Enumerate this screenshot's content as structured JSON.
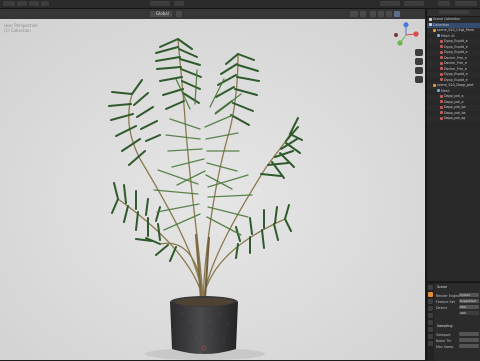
{
  "viewport": {
    "mode_label": "Global",
    "overlay_lines": [
      "User Perspective",
      "(1) Collection"
    ],
    "gizmo_axes": [
      "X",
      "Y",
      "Z"
    ],
    "background": "#dcdcdc"
  },
  "outliner": {
    "rows": [
      {
        "label": "Scene Collection",
        "icon": "collection-icon"
      },
      {
        "label": "Collection",
        "icon": "collection-icon"
      },
      {
        "label": "scene_S10_Clrgt_Parm",
        "icon": "object-icon"
      },
      {
        "label": "Mesh 41",
        "icon": "mesh-icon"
      },
      {
        "label": "Dypp_Euptd_e",
        "icon": "material-icon"
      },
      {
        "label": "Dypp_Euptd_e",
        "icon": "material-icon"
      },
      {
        "label": "Dypp_Euptd_e",
        "icon": "material-icon"
      },
      {
        "label": "Dschm_Frm_e",
        "icon": "material-icon"
      },
      {
        "label": "Dschm_Frm_e",
        "icon": "material-icon"
      },
      {
        "label": "Dschm_Frm_e",
        "icon": "material-icon"
      },
      {
        "label": "Dypp_Euptd_e",
        "icon": "material-icon"
      },
      {
        "label": "Dypp_Euptd_e",
        "icon": "material-icon"
      },
      {
        "label": "scene_S10_Dapp_port",
        "icon": "object-icon"
      },
      {
        "label": "Mesh",
        "icon": "mesh-icon"
      },
      {
        "label": "Dapp_pot_a",
        "icon": "material-icon"
      },
      {
        "label": "Dapp_pot_a",
        "icon": "material-icon"
      },
      {
        "label": "Dapp_pot_ba",
        "icon": "material-icon"
      },
      {
        "label": "Dapp_pot_ba",
        "icon": "material-icon"
      },
      {
        "label": "Dapp_pot_sg",
        "icon": "material-icon"
      }
    ]
  },
  "properties": {
    "section": "Scene",
    "rows": [
      {
        "label": "Render Engine",
        "value": "Cycles"
      },
      {
        "label": "Feature Set",
        "value": "Supported"
      },
      {
        "label": "Device",
        "value": "CPU"
      },
      {
        "label": "",
        "value": "GPU"
      }
    ],
    "subsection": "Sampling",
    "sub_rows": [
      {
        "label": "Viewport",
        "value": ""
      },
      {
        "label": "Noise Thr",
        "value": ""
      },
      {
        "label": "Max Samp",
        "value": ""
      }
    ],
    "accent": "#e08a3b",
    "selection": "#324b6e"
  }
}
